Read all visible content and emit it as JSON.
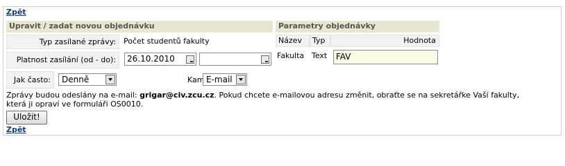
{
  "nav": {
    "back_top": "Zpět",
    "back_bottom": "Zpět"
  },
  "edit_section": {
    "title": "Upravit / zadat novou objednávku",
    "message_type_label": "Typ zasílané zprávy:",
    "message_type_value": "Počet studentů fakulty",
    "validity_label": "Platnost zasílání (od - do):",
    "date_from": "26.10.2010",
    "date_to": "",
    "frequency_label": "Jak často:",
    "frequency_value": "Denně",
    "where_label": "Kam:",
    "where_value": "E-mail"
  },
  "params_section": {
    "title": "Parametry objednávky",
    "columns": [
      "Název",
      "Typ",
      "Hodnota"
    ],
    "rows": [
      {
        "name": "Fakulta",
        "type": "Text",
        "value": "FAV"
      }
    ]
  },
  "note": {
    "prefix": "Zprávy budou odeslány na e-mail: ",
    "email": "grigar@civ.zcu.cz",
    "suffix": ". Pokud chcete e-mailovou adresu změnit, obraťte se na sekretářke Vaší fakulty,",
    "line2": "která ji opraví ve formuláři OS0010."
  },
  "save_button": "Uložit!"
}
